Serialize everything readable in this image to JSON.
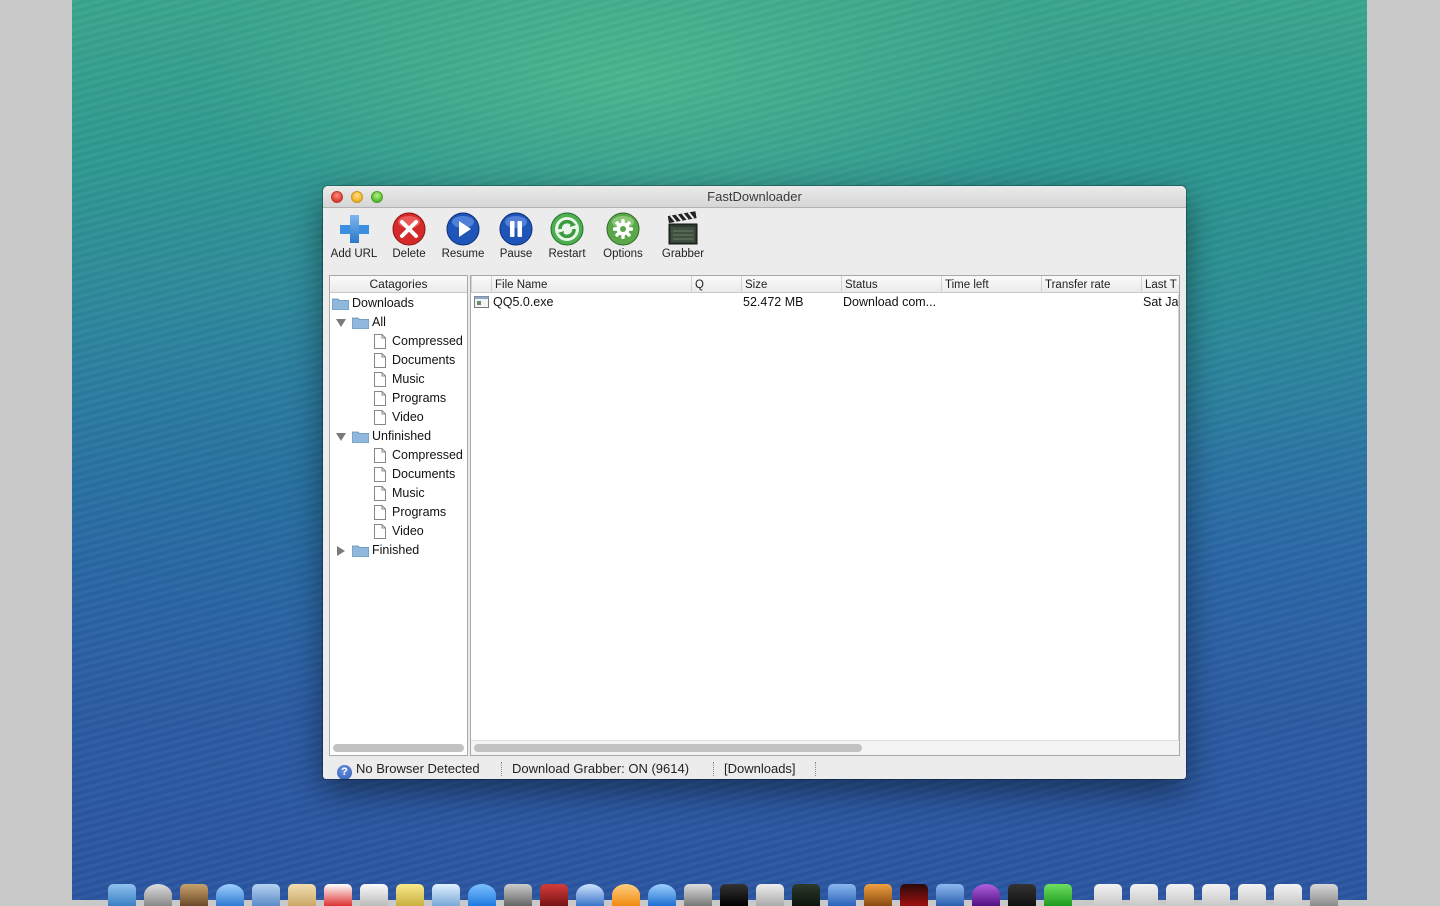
{
  "window": {
    "title": "FastDownloader"
  },
  "toolbar": {
    "buttons": [
      {
        "label": "Add URL",
        "icon": "plus-icon"
      },
      {
        "label": "Delete",
        "icon": "delete-icon"
      },
      {
        "label": "Resume",
        "icon": "play-icon"
      },
      {
        "label": "Pause",
        "icon": "pause-icon"
      },
      {
        "label": "Restart",
        "icon": "restart-icon"
      },
      {
        "label": "Options",
        "icon": "gear-icon"
      },
      {
        "label": "Grabber",
        "icon": "clapperboard-icon"
      }
    ]
  },
  "categories": {
    "header": "Catagories",
    "root": "Downloads",
    "groups": [
      {
        "label": "All",
        "expanded": true,
        "children": [
          "Compressed",
          "Documents",
          "Music",
          "Programs",
          "Video"
        ]
      },
      {
        "label": "Unfinished",
        "expanded": true,
        "children": [
          "Compressed",
          "Documents",
          "Music",
          "Programs",
          "Video"
        ]
      },
      {
        "label": "Finished",
        "expanded": false,
        "children": []
      }
    ]
  },
  "table": {
    "columns": [
      "File Name",
      "Q",
      "Size",
      "Status",
      "Time left",
      "Transfer rate",
      "Last T"
    ],
    "rows": [
      {
        "file_name": "QQ5.0.exe",
        "q": "",
        "size": "52.472 MB",
        "status": "Download com...",
        "time_left": "",
        "transfer_rate": "",
        "last": "Sat Jan"
      }
    ]
  },
  "statusbar": {
    "browser": "No Browser Detected",
    "grabber": "Download Grabber: ON (9614)",
    "category": "[Downloads]"
  },
  "colors": {
    "accent_blue": "#2c6fd6",
    "delete_red": "#d42a2a",
    "window_bg": "#ececec"
  }
}
